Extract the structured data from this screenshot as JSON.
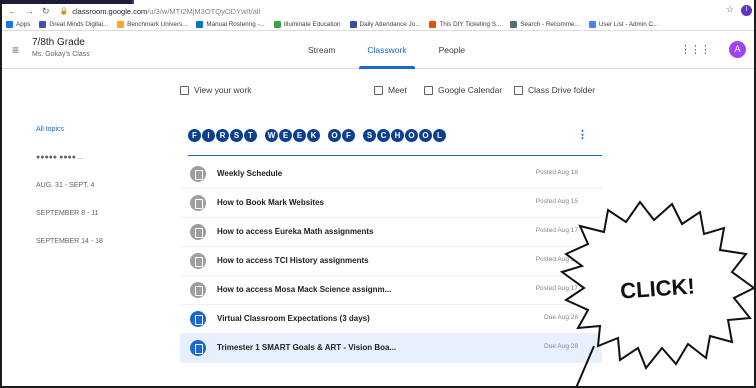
{
  "browser": {
    "url_host": "classroom.google.com",
    "url_path": "/u/3/w/MTI2MjM3OTQyODYw/t/all",
    "profile_letter": "I",
    "bookmarks": [
      {
        "label": "Apps",
        "color": "#1a73e8"
      },
      {
        "label": "Great Minds Digital...",
        "color": "#3f51b5"
      },
      {
        "label": "Benchmark Univers...",
        "color": "#f9a825"
      },
      {
        "label": "Manual Rostering -...",
        "color": "#0277bd"
      },
      {
        "label": "Illuminate Education",
        "color": "#43a047"
      },
      {
        "label": "Daily Attendance Jo...",
        "color": "#3949ab"
      },
      {
        "label": "This DIY Ticketing S...",
        "color": "#e65100"
      },
      {
        "label": "Search - Recomme...",
        "color": "#546e7a"
      },
      {
        "label": "User List - Admin C...",
        "color": "#4285f4"
      }
    ]
  },
  "header": {
    "class_name": "7/8th Grade",
    "class_sub": "Ms. Gokay's Class",
    "tabs": [
      "Stream",
      "Classwork",
      "People"
    ],
    "active_tab": "Classwork",
    "avatar_letter": "A"
  },
  "actions": {
    "view_work": "View your work",
    "meet": "Meet",
    "calendar": "Google Calendar",
    "drive": "Class Drive folder"
  },
  "sidebar": {
    "items": [
      "All topics",
      "●●●●● ●●●● ...",
      "AUG. 31 - SEPT. 4",
      "SEPTEMBER 8 - 11",
      "SEPTEMBER 14 - 18"
    ]
  },
  "topic": {
    "words": [
      "FIRST",
      "WEEK",
      "OF",
      "SCHOOL"
    ]
  },
  "assignments": [
    {
      "title": "Weekly Schedule",
      "date": "Posted Aug 18",
      "kind": "material"
    },
    {
      "title": "How to Book Mark Websites",
      "date": "Posted Aug 15",
      "kind": "material"
    },
    {
      "title": "How to access Eureka Math assignments",
      "date": "Posted Aug 17",
      "kind": "material"
    },
    {
      "title": "How to access TCI History assignments",
      "date": "Posted Aug 17",
      "kind": "material"
    },
    {
      "title": "How to access Mosa Mack Science assignm...",
      "date": "Posted Aug 17",
      "kind": "material"
    },
    {
      "title": "Virtual Classroom Expectations (3 days)",
      "date": "Due Aug 28",
      "kind": "assignment"
    },
    {
      "title": "Trimester 1 SMART Goals & ART - Vision Boa...",
      "date": "Due Aug 28",
      "kind": "assignment"
    }
  ],
  "callout": {
    "text": "CLICK!"
  }
}
